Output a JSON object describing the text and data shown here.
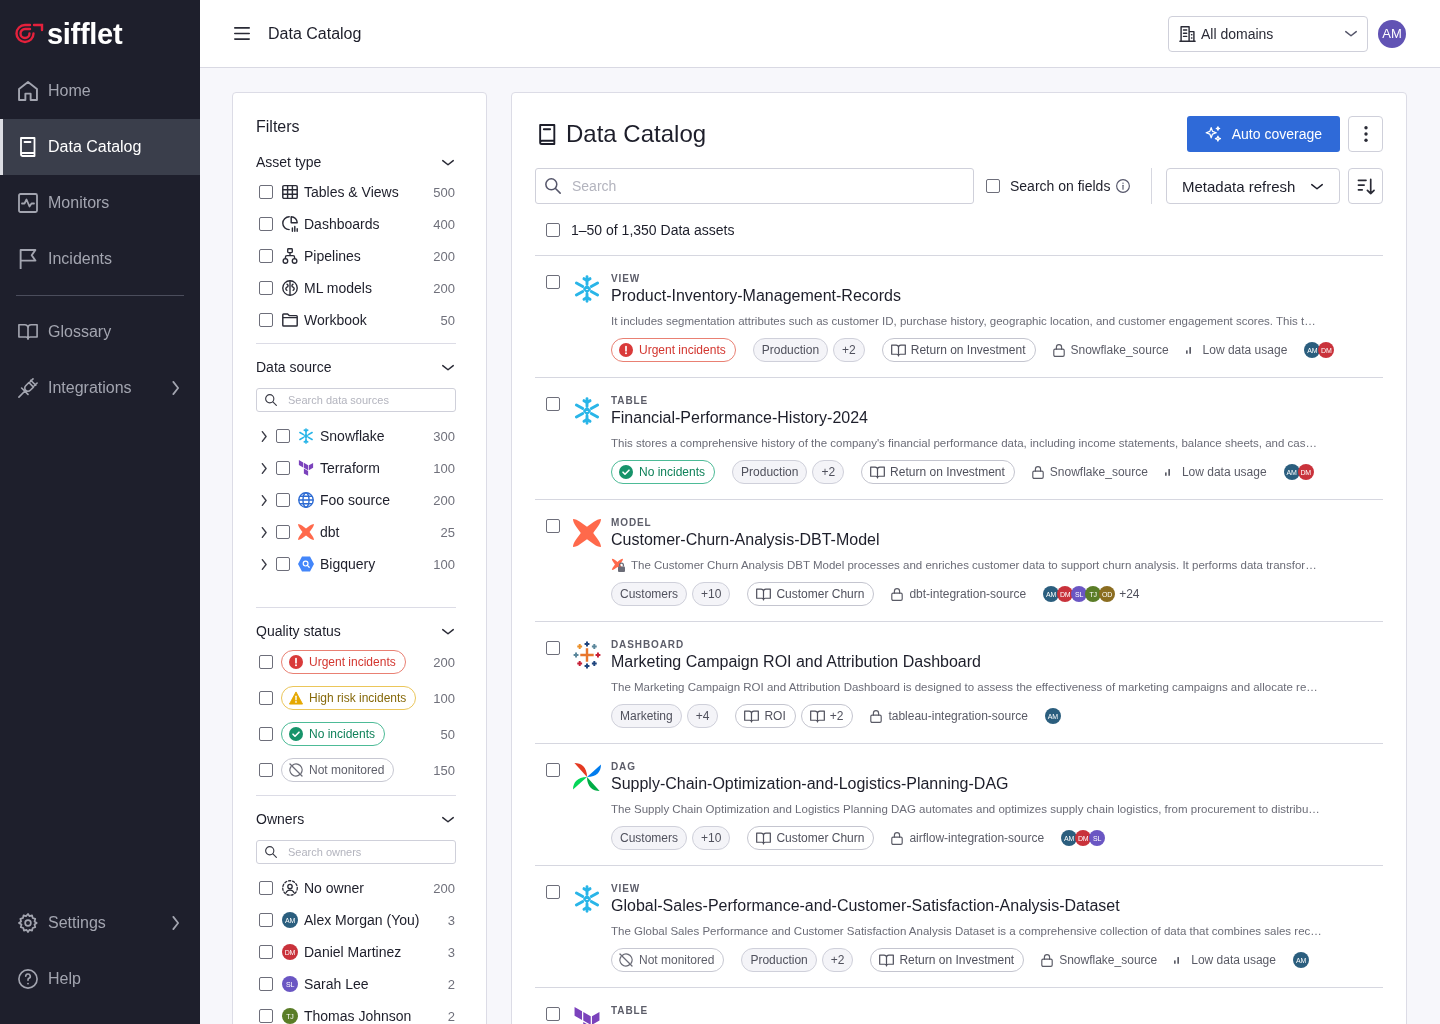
{
  "sidebar": {
    "logo": "sifflet",
    "primary": [
      {
        "label": "Home",
        "selected": false,
        "expandable": false
      },
      {
        "label": "Data Catalog",
        "selected": true,
        "expandable": false
      },
      {
        "label": "Monitors",
        "selected": false,
        "expandable": false
      },
      {
        "label": "Incidents",
        "selected": false,
        "expandable": false
      }
    ],
    "secondary": [
      {
        "label": "Glossary",
        "selected": false,
        "expandable": false
      },
      {
        "label": "Integrations",
        "selected": false,
        "expandable": true
      }
    ],
    "footer": [
      {
        "label": "Settings",
        "selected": false,
        "expandable": true
      },
      {
        "label": "Help",
        "selected": false,
        "expandable": false
      }
    ]
  },
  "topbar": {
    "title": "Data Catalog",
    "domain_select": {
      "value": "All domains"
    },
    "user": {
      "initials": "AM"
    }
  },
  "filters": {
    "title": "Filters",
    "sections": [
      {
        "kind": "asset_types",
        "title": "Asset type",
        "expanded": true,
        "items": [
          {
            "label": "Tables & Views",
            "count": "500",
            "checked": false
          },
          {
            "label": "Dashboards",
            "count": "400",
            "checked": false
          },
          {
            "label": "Pipelines",
            "count": "200",
            "checked": false
          },
          {
            "label": "ML models",
            "count": "200",
            "checked": false
          },
          {
            "label": "Workbook",
            "count": "50",
            "checked": false
          }
        ]
      },
      {
        "kind": "sources",
        "title": "Data source",
        "expanded": true,
        "search_placeholder": "Search data sources",
        "items": [
          {
            "label": "Snowflake",
            "count": "300",
            "checked": false,
            "expanded": false
          },
          {
            "label": "Terraform",
            "count": "100",
            "checked": false,
            "expanded": false
          },
          {
            "label": "Foo source",
            "count": "200",
            "checked": false,
            "expanded": false
          },
          {
            "label": "dbt",
            "count": "25",
            "checked": false,
            "expanded": false
          },
          {
            "label": "Bigquery",
            "count": "100",
            "checked": false,
            "expanded": false
          }
        ]
      },
      {
        "kind": "statuses",
        "title": "Quality status",
        "expanded": true,
        "items": [
          {
            "kind": "urgent",
            "label": "Urgent incidents",
            "count": "200",
            "checked": false
          },
          {
            "kind": "high_risk",
            "label": "High risk incidents",
            "count": "100",
            "checked": false
          },
          {
            "kind": "ok",
            "label": "No incidents",
            "count": "50",
            "checked": false
          },
          {
            "kind": "not_monitored",
            "label": "Not monitored",
            "count": "150",
            "checked": false
          }
        ]
      },
      {
        "kind": "owners",
        "title": "Owners",
        "expanded": true,
        "search_placeholder": "Search owners",
        "items": [
          {
            "kind": "none",
            "label": "No owner",
            "count": "200",
            "checked": false
          },
          {
            "kind": "person",
            "initials": "AM",
            "color": "#2b5e7e",
            "label": "Alex Morgan (You)",
            "count": "3",
            "checked": false
          },
          {
            "kind": "person",
            "initials": "DM",
            "color": "#c9323b",
            "label": "Daniel Martinez",
            "count": "3",
            "checked": false
          },
          {
            "kind": "person",
            "initials": "SL",
            "color": "#6a56c3",
            "label": "Sarah Lee",
            "count": "2",
            "checked": false
          },
          {
            "kind": "person",
            "initials": "TJ",
            "color": "#5a7d27",
            "label": "Thomas Johnson",
            "count": "2",
            "checked": false
          }
        ]
      }
    ]
  },
  "catalog": {
    "title": "Data Catalog",
    "primary_action": "Auto coverage",
    "search": {
      "placeholder": "Search"
    },
    "search_on_fields": {
      "label": "Search on fields",
      "checked": false
    },
    "refresh_select": {
      "value": "Metadata refresh"
    },
    "summary": {
      "label": "1–50 of 1,350 Data assets",
      "checked": false
    },
    "assets": [
      {
        "type": "VIEW",
        "name": "Product-Inventory-Management-Records",
        "checked": false,
        "restricted": false,
        "description": "It includes segmentation attributes such as customer ID, purchase history, geographic location, and customer engagement scores. This t…",
        "status": {
          "kind": "urgent",
          "label": "Urgent incidents"
        },
        "tags": [
          "Production",
          "+2"
        ],
        "terms": [
          "Return on Investment"
        ],
        "source": "Snowflake_source",
        "usage": "Low data usage",
        "owners": [
          {
            "initials": "AM",
            "color": "#2b5e7e"
          },
          {
            "initials": "DM",
            "color": "#c9323b"
          }
        ]
      },
      {
        "type": "TABLE",
        "name": "Financial-Performance-History-2024",
        "checked": false,
        "restricted": false,
        "description": "This stores a comprehensive history of the company's financial performance data, including income statements, balance sheets, and cas…",
        "status": {
          "kind": "ok",
          "label": "No incidents"
        },
        "tags": [
          "Production",
          "+2"
        ],
        "terms": [
          "Return on Investment"
        ],
        "source": "Snowflake_source",
        "usage": "Low data usage",
        "owners": [
          {
            "initials": "AM",
            "color": "#2b5e7e"
          },
          {
            "initials": "DM",
            "color": "#c9323b"
          }
        ]
      },
      {
        "type": "MODEL",
        "name": "Customer-Churn-Analysis-DBT-Model",
        "checked": false,
        "restricted": true,
        "description": "The Customer Churn Analysis DBT Model processes and enriches customer data to support churn analysis. It performs data transfor…",
        "tags": [
          "Customers",
          "+10"
        ],
        "terms": [
          "Customer Churn"
        ],
        "source": "dbt-integration-source",
        "owners": [
          {
            "initials": "AM",
            "color": "#2b5e7e"
          },
          {
            "initials": "DM",
            "color": "#c9323b"
          },
          {
            "initials": "SL",
            "color": "#6a56c3"
          },
          {
            "initials": "TJ",
            "color": "#5a7d27"
          },
          {
            "initials": "OD",
            "color": "#8b6d20"
          }
        ],
        "more_owners": "+24"
      },
      {
        "type": "DASHBOARD",
        "name": "Marketing Campaign ROI and Attribution Dashboard",
        "checked": false,
        "restricted": false,
        "description": "The Marketing Campaign ROI and Attribution Dashboard is designed to assess the effectiveness of marketing campaigns and allocate re…",
        "tags": [
          "Marketing",
          "+4"
        ],
        "terms": [
          "ROI",
          "+2"
        ],
        "source": "tableau-integration-source",
        "owners": [
          {
            "initials": "AM",
            "color": "#2b5e7e"
          }
        ]
      },
      {
        "type": "DAG",
        "name": "Supply-Chain-Optimization-and-Logistics-Planning-DAG",
        "checked": false,
        "restricted": false,
        "description": "The Supply Chain Optimization and Logistics Planning DAG automates and optimizes supply chain logistics, from procurement to distribu…",
        "tags": [
          "Customers",
          "+10"
        ],
        "terms": [
          "Customer Churn"
        ],
        "source": "airflow-integration-source",
        "owners": [
          {
            "initials": "AM",
            "color": "#2b5e7e"
          },
          {
            "initials": "DM",
            "color": "#c9323b"
          },
          {
            "initials": "SL",
            "color": "#6a56c3"
          }
        ]
      },
      {
        "type": "VIEW",
        "name": "Global-Sales-Performance-and-Customer-Satisfaction-Analysis-Dataset",
        "checked": false,
        "restricted": false,
        "description": "The Global Sales Performance and Customer Satisfaction Analysis Dataset is a comprehensive collection of data that combines sales rec…",
        "status": {
          "kind": "not_monitored",
          "label": "Not monitored"
        },
        "tags": [
          "Production",
          "+2"
        ],
        "terms": [
          "Return on Investment"
        ],
        "source": "Snowflake_source",
        "usage": "Low data usage",
        "owners": [
          {
            "initials": "AM",
            "color": "#2b5e7e"
          }
        ]
      },
      {
        "type": "TABLE",
        "checked": false
      }
    ]
  }
}
